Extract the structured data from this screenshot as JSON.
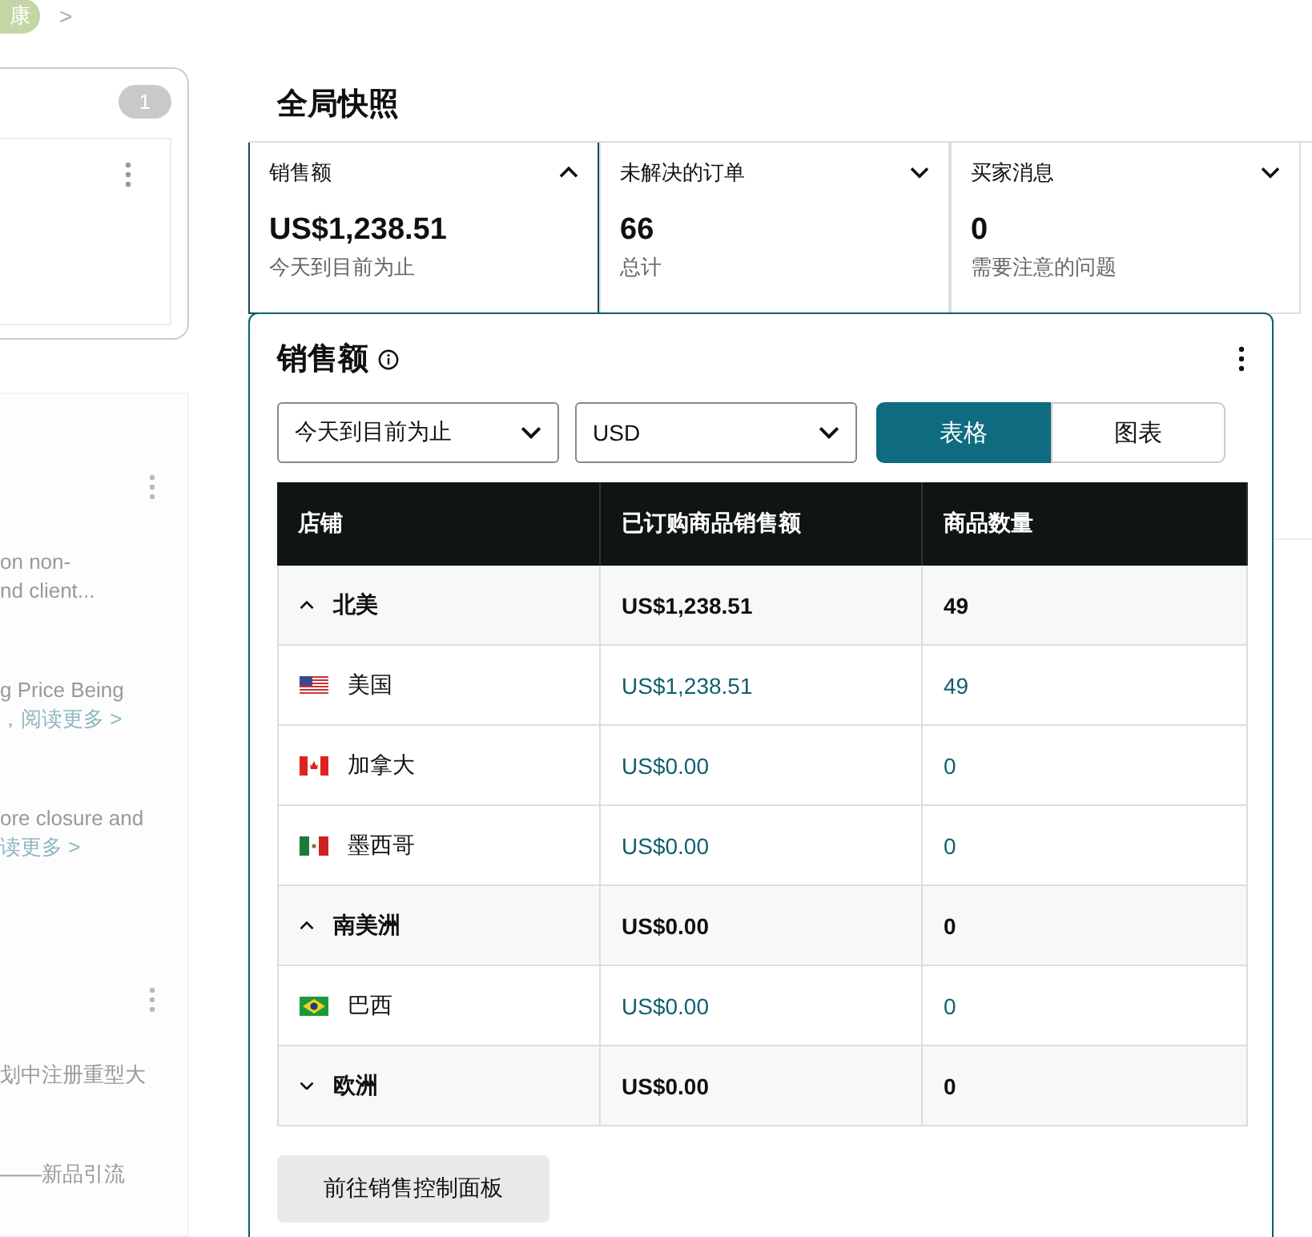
{
  "breadcrumb": {
    "tag": "康",
    "separator": ">"
  },
  "left_panel": {
    "badge": "1",
    "lines": [
      {
        "kind": "text",
        "text": "on non-"
      },
      {
        "kind": "text",
        "text": "nd client..."
      },
      {
        "kind": "gap"
      },
      {
        "kind": "text",
        "text": "g Price Being"
      },
      {
        "kind": "link",
        "text": "，阅读更多 >"
      },
      {
        "kind": "gap"
      },
      {
        "kind": "text",
        "text": "ore closure and"
      },
      {
        "kind": "link",
        "text": "读更多 >"
      }
    ],
    "lines2": [
      {
        "kind": "text",
        "text": "划中注册重型大"
      },
      {
        "kind": "gap"
      },
      {
        "kind": "text",
        "text": "——新品引流"
      }
    ]
  },
  "snapshot": {
    "title": "全局快照",
    "cards": [
      {
        "label": "销售额",
        "value": "US$1,238.51",
        "caption": "今天到目前为止",
        "expanded": true
      },
      {
        "label": "未解决的订单",
        "value": "66",
        "caption": "总计",
        "expanded": false
      },
      {
        "label": "买家消息",
        "value": "0",
        "caption": "需要注意的问题",
        "expanded": false
      }
    ]
  },
  "sales_panel": {
    "title": "销售额",
    "filters": [
      {
        "value": "今天到目前为止"
      },
      {
        "value": "USD"
      }
    ],
    "view_tabs": [
      {
        "label": "表格",
        "selected": true
      },
      {
        "label": "图表",
        "selected": false
      }
    ],
    "table": {
      "columns": [
        "店铺",
        "已订购商品销售额",
        "商品数量"
      ],
      "rows": [
        {
          "kind": "group",
          "store": "北美",
          "expanded": true,
          "sales": "US$1,238.51",
          "units": "49"
        },
        {
          "kind": "us",
          "store": "美国",
          "sales": "US$1,238.51",
          "units": "49"
        },
        {
          "kind": "ca",
          "store": "加拿大",
          "sales": "US$0.00",
          "units": "0"
        },
        {
          "kind": "mx",
          "store": "墨西哥",
          "sales": "US$0.00",
          "units": "0"
        },
        {
          "kind": "group",
          "store": "南美洲",
          "expanded": true,
          "sales": "US$0.00",
          "units": "0"
        },
        {
          "kind": "br",
          "store": "巴西",
          "sales": "US$0.00",
          "units": "0"
        },
        {
          "kind": "group",
          "store": "欧洲",
          "expanded": false,
          "sales": "US$0.00",
          "units": "0"
        }
      ]
    },
    "button": "前往销售控制面板"
  }
}
